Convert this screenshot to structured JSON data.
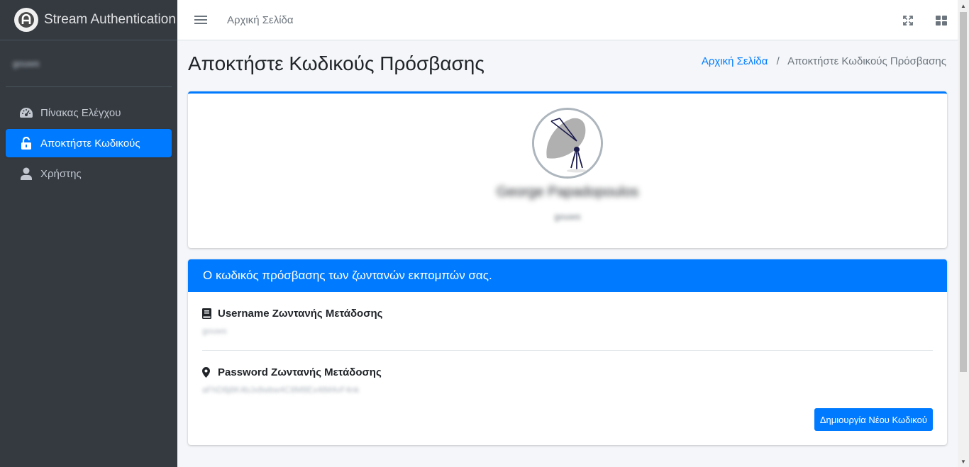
{
  "brand": {
    "title": "Stream Authentication",
    "logo_icon": "stream-logo-icon"
  },
  "sidebar": {
    "user_name": "gouws",
    "items": [
      {
        "label": "Πίνακας Ελέγχου",
        "icon": "tachometer-icon",
        "active": false
      },
      {
        "label": "Αποκτήστε Κωδικούς",
        "icon": "unlock-icon",
        "active": true
      },
      {
        "label": "Χρήστης",
        "icon": "user-icon",
        "active": false
      }
    ]
  },
  "topbar": {
    "home_link": "Αρχική Σελίδα",
    "icons": [
      "fullscreen-icon",
      "grid-icon"
    ]
  },
  "page": {
    "title": "Αποκτήστε Κωδικούς Πρόσβασης",
    "breadcrumb": {
      "home": "Αρχική Σελίδα",
      "separator": "/",
      "current": "Αποκτήστε Κωδικούς Πρόσβασης"
    }
  },
  "profile": {
    "name": "George Papadopoulos",
    "username": "gouws"
  },
  "credentials": {
    "header": "Ο κωδικός πρόσβασης των ζωντανών εκπομπών σας.",
    "username_label": "Username Ζωντανής Μετάδοσης",
    "username_value": "gouws",
    "password_label": "Password Ζωντανής Μετάδοσης",
    "password_value": "aFhD8j8K4bJx8wbw4C8M8Ex4tM4vF4nk",
    "new_button": "Δημιουργία Νέου Κωδικού"
  },
  "colors": {
    "primary": "#007bff",
    "sidebar_bg": "#343a40",
    "content_bg": "#f4f6f9"
  }
}
